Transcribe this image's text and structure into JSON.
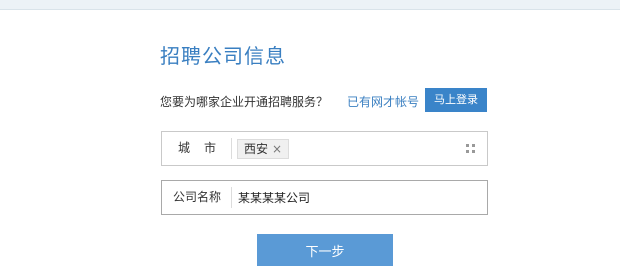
{
  "page": {
    "title": "招聘公司信息"
  },
  "prompt": {
    "question": "您要为哪家企业开通招聘服务？",
    "has_account": "已有网才帐号",
    "login_label": "马上登录"
  },
  "city": {
    "label": "城市",
    "selected": "西安",
    "remove_symbol": "×",
    "picker_icon": "grid-icon"
  },
  "company": {
    "label": "公司名称",
    "value": "某某某某公司"
  },
  "next": {
    "label": "下一步"
  },
  "colors": {
    "accent": "#3a7fc1",
    "login_button": "#3a84c9",
    "next_button": "#5a9ad6",
    "top_band": "#ecf2f7"
  }
}
